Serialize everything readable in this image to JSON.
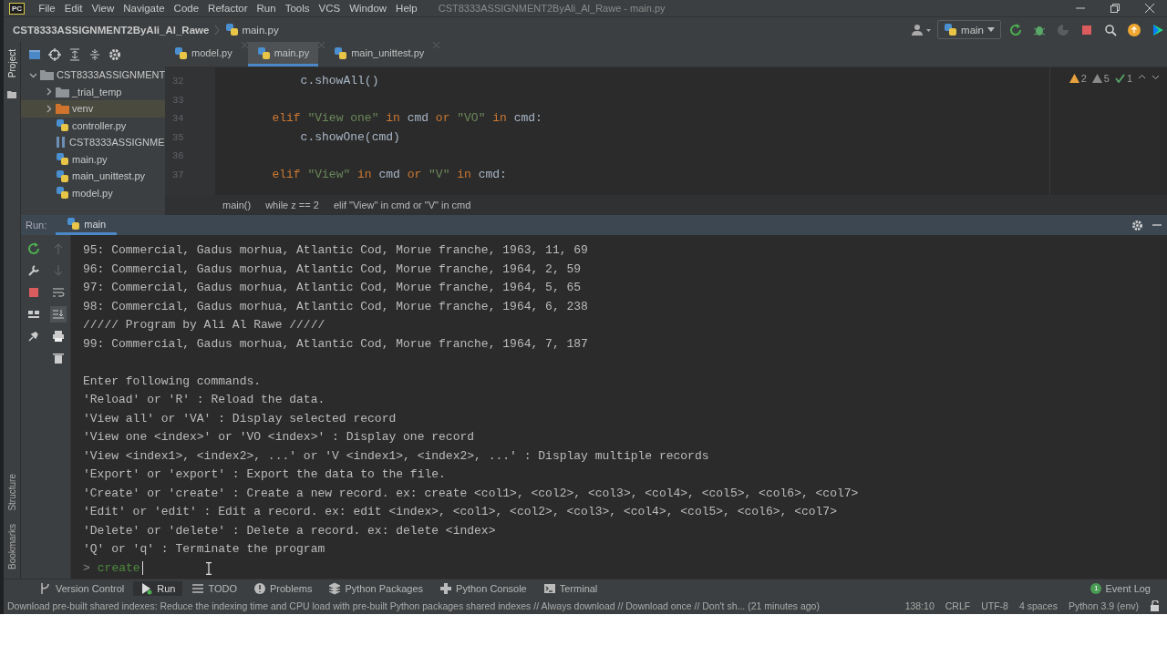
{
  "menu_bar": {
    "logo": "PC",
    "items": [
      "File",
      "Edit",
      "View",
      "Navigate",
      "Code",
      "Refactor",
      "Run",
      "Tools",
      "VCS",
      "Window",
      "Help"
    ],
    "title": "CST8333ASSIGNMENT2ByAli_Al_Rawe - main.py"
  },
  "nav_bar": {
    "project": "CST8333ASSIGNMENT2ByAli_Al_Rawe",
    "file": "main.py",
    "run_config": "main"
  },
  "left_stripe": {
    "top": [
      "Project"
    ],
    "bottom": [
      "Structure",
      "Bookmarks"
    ]
  },
  "project_tree": [
    {
      "label": "CST8333ASSIGNMENT",
      "kind": "folder",
      "expanded": true,
      "selected": false,
      "children": [
        {
          "label": "_trial_temp",
          "kind": "folder",
          "expanded": false,
          "selected": false
        },
        {
          "label": "venv",
          "kind": "excluded-folder",
          "expanded": false,
          "selected": true
        },
        {
          "label": "controller.py",
          "kind": "python",
          "selected": false
        },
        {
          "label": "CST8333ASSIGNME",
          "kind": "text",
          "selected": false
        },
        {
          "label": "main.py",
          "kind": "python",
          "selected": false
        },
        {
          "label": "main_unittest.py",
          "kind": "python",
          "selected": false
        },
        {
          "label": "model.py",
          "kind": "python",
          "selected": false
        }
      ]
    }
  ],
  "editor": {
    "tabs": [
      {
        "label": "model.py",
        "selected": false
      },
      {
        "label": "main.py",
        "selected": true
      },
      {
        "label": "main_unittest.py",
        "selected": false
      }
    ],
    "lines": [
      {
        "number": "32",
        "tokens": [
          {
            "kind": "plain",
            "text": "            c.showAll()"
          }
        ]
      },
      {
        "number": "33"
      },
      {
        "number": "34",
        "tokens": [
          {
            "kind": "keyword",
            "text": "        elif "
          },
          {
            "kind": "string",
            "text": "\"View one\""
          },
          {
            "kind": "keyword",
            "text": " in"
          },
          {
            "kind": "plain",
            "text": " cmd "
          },
          {
            "kind": "keyword",
            "text": "or "
          },
          {
            "kind": "string",
            "text": "\"VO\""
          },
          {
            "kind": "keyword",
            "text": " in"
          },
          {
            "kind": "plain",
            "text": " cmd:"
          }
        ]
      },
      {
        "number": "35",
        "tokens": [
          {
            "kind": "plain",
            "text": "            c.showOne(cmd)"
          }
        ]
      },
      {
        "number": "36"
      },
      {
        "number": "37",
        "tokens": [
          {
            "kind": "keyword",
            "text": "        elif "
          },
          {
            "kind": "string",
            "text": "\"View\""
          },
          {
            "kind": "keyword",
            "text": " in"
          },
          {
            "kind": "plain",
            "text": " cmd "
          },
          {
            "kind": "keyword",
            "text": "or "
          },
          {
            "kind": "string",
            "text": "\"V\""
          },
          {
            "kind": "keyword",
            "text": " in"
          },
          {
            "kind": "plain",
            "text": " cmd:"
          }
        ]
      }
    ],
    "inspections": {
      "errors": "2",
      "warnings": "5",
      "ok": "1"
    },
    "breadcrumbs": [
      "main()",
      "while z == 2",
      "elif \"View\" in cmd or \"V\" in cmd"
    ]
  },
  "run_panel": {
    "label": "Run:",
    "tab": "main",
    "blocks": [
      [
        "95: Commercial, Gadus morhua, Atlantic Cod, Morue franche, 1963, 11, 69",
        "96: Commercial, Gadus morhua, Atlantic Cod, Morue franche, 1964, 2, 59",
        "97: Commercial, Gadus morhua, Atlantic Cod, Morue franche, 1964, 5, 65",
        "98: Commercial, Gadus morhua, Atlantic Cod, Morue franche, 1964, 6, 238",
        "///// Program by Ali Al Rawe /////",
        "99: Commercial, Gadus morhua, Atlantic Cod, Morue franche, 1964, 7, 187"
      ],
      [
        "Enter following commands.",
        "'Reload' or 'R' : Reload the data.",
        "'View all' or 'VA' : Display selected record",
        "'View one <index>' or 'VO <index>' : Display one record",
        "'View <index1>, <index2>, ...' or 'V <index1>, <index2>, ...' : Display multiple records",
        "'Export' or 'export' : Export the data to the file.",
        "'Create' or 'create' : Create a new record. ex: create <col1>, <col2>, <col3>, <col4>, <col5>, <col6>, <col7>",
        "'Edit' or 'edit' : Edit a record. ex: edit <index>, <col1>, <col2>, <col3>, <col4>, <col5>, <col6>, <col7>",
        "'Delete' or 'delete' : Delete a record. ex: delete <index>",
        "'Q' or 'q' : Terminate the program"
      ]
    ],
    "prompt": ">",
    "input": "create"
  },
  "tool_windows": [
    {
      "label": "Version Control",
      "selected": false
    },
    {
      "label": "Run",
      "selected": true
    },
    {
      "label": "TODO",
      "selected": false
    },
    {
      "label": "Problems",
      "selected": false
    },
    {
      "label": "Python Packages",
      "selected": false
    },
    {
      "label": "Python Console",
      "selected": false
    },
    {
      "label": "Terminal",
      "selected": false
    }
  ],
  "event_log": {
    "label": "Event Log",
    "badge": "1"
  },
  "status_bar": {
    "message": "Download pre-built shared indexes: Reduce the indexing time and CPU load with pre-built Python packages shared indexes // Always download // Download once // Don't sh... (21 minutes ago)",
    "items": [
      "138:10",
      "CRLF",
      "UTF-8",
      "4 spaces",
      "Python 3.9 (env)"
    ]
  }
}
